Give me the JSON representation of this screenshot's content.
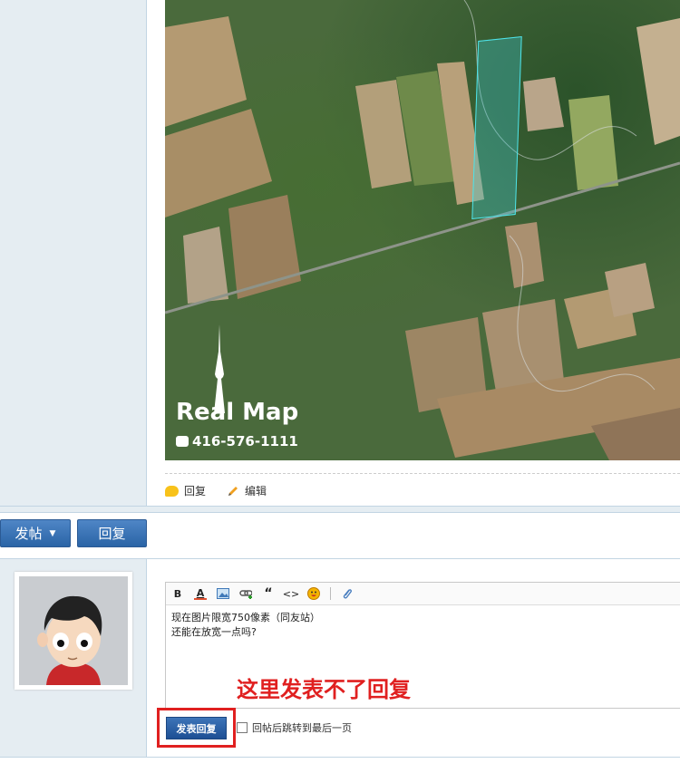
{
  "post": {
    "map": {
      "brand": "Real Map",
      "phone": "416-576-1111"
    },
    "actions": {
      "reply_label": "回复",
      "edit_label": "编辑"
    }
  },
  "buttons": {
    "post_label": "发帖",
    "reply_label": "回复"
  },
  "editor": {
    "toolbar": [
      "B",
      "A",
      "image",
      "link",
      "quote",
      "code",
      "emoji",
      "attach"
    ],
    "content_line1": "现在图片限宽750像素（同友站）",
    "content_line2": "还能在放宽一点吗?"
  },
  "annotation": "这里发表不了回复",
  "submit": {
    "label": "发表回复",
    "jump_label": "回帖后跳转到最后一页"
  },
  "colors": {
    "sidebar_bg": "#e5edf2",
    "button_blue": "#2a64a6",
    "annotation_red": "#e02020",
    "parcel_cyan": "#4ee3e8"
  }
}
